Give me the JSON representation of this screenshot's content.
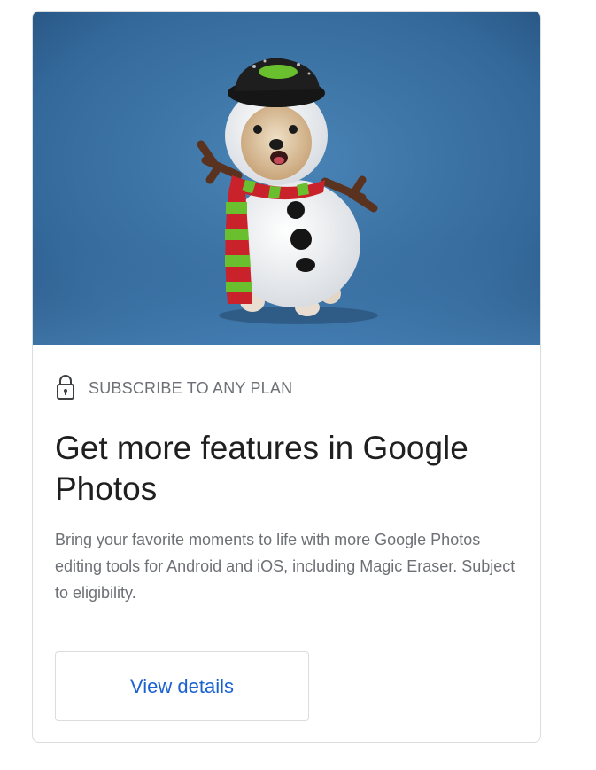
{
  "card": {
    "hero_image": "dog-snowman-costume-photo",
    "eyebrow": {
      "icon": "lock-icon",
      "text": "SUBSCRIBE TO ANY PLAN"
    },
    "title": "Get more features in Google Photos",
    "description": "Bring your favorite moments to life with more Google Photos editing tools for Android and iOS, including Magic Eraser. Subject to eligibility.",
    "cta_label": "View details"
  },
  "colors": {
    "eyebrow_text": "#6d7075",
    "title_text": "#1f1f1f",
    "link_blue": "#1a62d1",
    "border": "#dadce0",
    "hero_background": "#3a6fa0"
  }
}
